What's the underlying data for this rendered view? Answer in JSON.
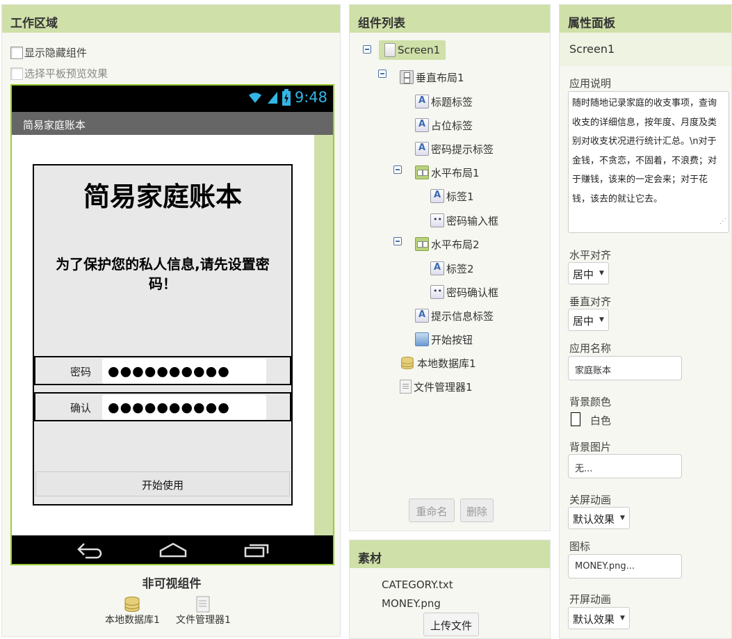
{
  "workspace": {
    "title": "工作区域",
    "show_hidden_label": "显示隐藏组件",
    "tablet_preview_label": "选择平板预览效果",
    "phone": {
      "time": "9:48",
      "app_title": "简易家庭账本",
      "big_title": "简易家庭账本",
      "subtitle": "为了保护您的私人信息,请先设置密码！",
      "password_label": "密码",
      "password_value": "●●●●●●●●●●",
      "confirm_label": "确认",
      "confirm_value": "●●●●●●●●●●",
      "start_button": "开始使用"
    },
    "nonvisible_title": "非可视组件",
    "nonvisible_items": [
      "本地数据库1",
      "文件管理器1"
    ]
  },
  "components": {
    "title": "组件列表",
    "tree": [
      "Screen1",
      "垂直布局1",
      "标题标签",
      "占位标签",
      "密码提示标签",
      "水平布局1",
      "标签1",
      "密码输入框",
      "水平布局2",
      "标签2",
      "密码确认框",
      "提示信息标签",
      "开始按钮",
      "本地数据库1",
      "文件管理器1"
    ],
    "rename_button": "重命名",
    "delete_button": "删除"
  },
  "assets": {
    "title": "素材",
    "files": [
      "CATEGORY.txt",
      "MONEY.png"
    ],
    "upload_button": "上传文件"
  },
  "properties": {
    "title": "属性面板",
    "screen_name": "Screen1",
    "about_label": "应用说明",
    "about_value": "随时随地记录家庭的收支事项，查询收支的详细信息，按年度、月度及类别对收支状况进行统计汇总。\\n对于金钱，不贪恋，不固着，不浪费；对于赚钱，该来的一定会来；对于花钱，该去的就让它去。",
    "halign_label": "水平对齐",
    "halign_value": "居中",
    "valign_label": "垂直对齐",
    "valign_value": "居中",
    "appname_label": "应用名称",
    "appname_value": "家庭账本",
    "bgcolor_label": "背景颜色",
    "bgcolor_value": "白色",
    "bgimage_label": "背景图片",
    "bgimage_value": "无...",
    "close_anim_label": "关屏动画",
    "close_anim_value": "默认效果",
    "icon_label": "图标",
    "icon_value": "MONEY.png...",
    "open_anim_label": "开屏动画",
    "open_anim_value": "默认效果"
  },
  "colors": {
    "header_green": "#cfe0a8",
    "phone_border": "#9acd32",
    "status_blue": "#33b5e5"
  }
}
